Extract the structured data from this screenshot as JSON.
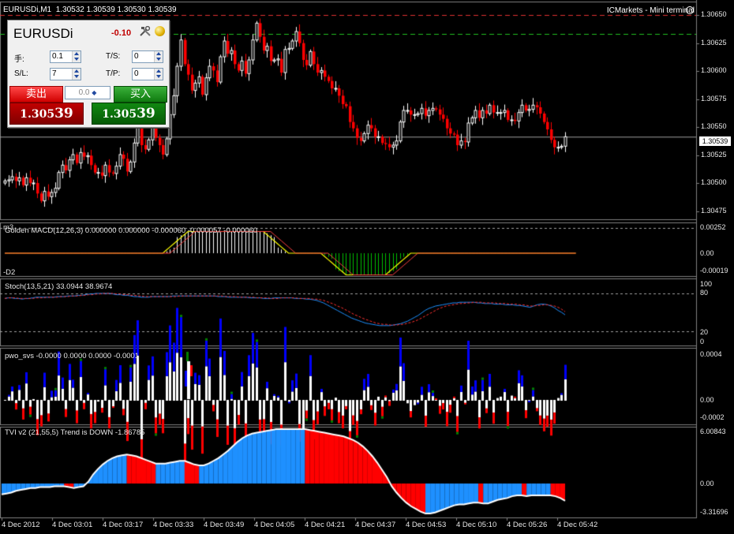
{
  "chart_header": {
    "symbol_tf": "EURUSDi,M1",
    "ohlc": "1.30532 1.30539 1.30530 1.30539",
    "broker": "ICMarkets - Mini terminal"
  },
  "mini_terminal": {
    "symbol": "EURUSDi",
    "pnl": "-0.10",
    "lots_label": "手:",
    "lots_value": "0.1",
    "ts_label": "T/S:",
    "ts_value": "0",
    "sl_label": "S/L:",
    "sl_value": "7",
    "tp_label": "T/P:",
    "tp_value": "0",
    "sell_label": "卖出",
    "buy_label": "买入",
    "spread_value": "0.0",
    "sell_price_main": "1.305",
    "sell_price_big": "39",
    "buy_price_main": "1.305",
    "buy_price_big": "39"
  },
  "colors": {
    "background": "#000000",
    "bull": "#ffffff",
    "bear": "#ff0000",
    "grid": "#5a5a5a",
    "axis_text": "#e8e8e8",
    "macd_signal": "#ffff00",
    "macd_hist_up": "#ffffff",
    "macd_hist_down": "#00c000",
    "stoch_main": "#1e90ff",
    "stoch_signal": "#ff3030",
    "pwo_blue": "#0000ff",
    "pwo_red": "#ff0000",
    "pwo_green": "#008000",
    "tvi_blue": "#1e90ff",
    "tvi_red": "#ff0000"
  },
  "price_axis": {
    "labels": [
      "1.30650",
      "1.30625",
      "1.30600",
      "1.30575",
      "1.30550",
      "1.30525",
      "1.30500",
      "1.30475"
    ],
    "current": "1.30539"
  },
  "panes": {
    "macd": {
      "title": "Golden MACD(12,26,3) 0.000000 0.000000 -0.000060 -0.000057 -0.000060",
      "corner": "m3",
      "sublabel": "-D2",
      "axis": [
        "0.00252",
        "0.00",
        "-0.00019"
      ]
    },
    "stoch": {
      "title": "Stoch(13,5,21) 33.0944 38.9674",
      "axis": [
        "100",
        "80",
        "20",
        "0"
      ]
    },
    "pwo": {
      "title": "pwo_svs -0.0000 0.0000 0.0000 -0.0001",
      "axis": [
        "0.0004",
        "0.00",
        "-0.0002"
      ]
    },
    "tvi": {
      "title": "TVI v2 (21,55,5) Trend is DOWN -1.86785",
      "axis": [
        "6.00843",
        "0.00",
        "-3.31696"
      ]
    }
  },
  "time_axis": [
    "4 Dec 2012",
    "4 Dec 03:01",
    "4 Dec 03:17",
    "4 Dec 03:33",
    "4 Dec 03:49",
    "4 Dec 04:05",
    "4 Dec 04:21",
    "4 Dec 04:37",
    "4 Dec 04:53",
    "4 Dec 05:10",
    "4 Dec 05:26",
    "4 Dec 05:42"
  ],
  "chart_data": {
    "type": "candlestick",
    "price_range": [
      1.30462,
      1.30663
    ],
    "current_price": 1.30539,
    "closes": [
      1.30497,
      1.30498,
      1.30501,
      1.30497,
      1.305,
      1.30493,
      1.305,
      1.30495,
      1.30495,
      1.30485,
      1.30478,
      1.30487,
      1.30482,
      1.30486,
      1.3049,
      1.30505,
      1.30512,
      1.30507,
      1.30517,
      1.30522,
      1.30514,
      1.30524,
      1.3052,
      1.30521,
      1.30512,
      1.30505,
      1.30505,
      1.30502,
      1.30512,
      1.30505,
      1.30504,
      1.30511,
      1.30522,
      1.30518,
      1.30506,
      1.30515,
      1.30533,
      1.30555,
      1.30531,
      1.30527,
      1.30536,
      1.30548,
      1.30538,
      1.30531,
      1.30522,
      1.30537,
      1.3056,
      1.30578,
      1.30606,
      1.30631,
      1.30608,
      1.30598,
      1.30583,
      1.3059,
      1.30596,
      1.30579,
      1.30595,
      1.30606,
      1.30602,
      1.30591,
      1.30615,
      1.3063,
      1.30618,
      1.30621,
      1.30608,
      1.30602,
      1.30611,
      1.30599,
      1.30612,
      1.30631,
      1.30647,
      1.30634,
      1.30621,
      1.30625,
      1.30611,
      1.30612,
      1.30613,
      1.306,
      1.30622,
      1.30623,
      1.3063,
      1.30639,
      1.30628,
      1.30612,
      1.30607,
      1.3062,
      1.30608,
      1.306,
      1.30602,
      1.30596,
      1.30592,
      1.30585,
      1.30585,
      1.30578,
      1.3057,
      1.30568,
      1.30553,
      1.30547,
      1.30538,
      1.30535,
      1.30542,
      1.3055,
      1.30547,
      1.30539,
      1.30539,
      1.30533,
      1.30532,
      1.30529,
      1.30531,
      1.30535,
      1.30553,
      1.30564,
      1.30564,
      1.3056,
      1.3056,
      1.30561,
      1.30566,
      1.30559,
      1.30564,
      1.30566,
      1.30565,
      1.3056,
      1.30556,
      1.30547,
      1.30542,
      1.30541,
      1.30531,
      1.30535,
      1.30534,
      1.30552,
      1.30557,
      1.30564,
      1.30557,
      1.30564,
      1.30561,
      1.30569,
      1.30562,
      1.30562,
      1.30562,
      1.30564,
      1.30555,
      1.30555,
      1.30554,
      1.30562,
      1.30569,
      1.30564,
      1.30565,
      1.30569,
      1.30567,
      1.30561,
      1.30553,
      1.30546,
      1.30536,
      1.30529,
      1.30529,
      1.3053,
      1.30539
    ],
    "macd_hist": [
      0.0,
      -0.0,
      -0.0,
      -0.0,
      -0.0,
      -0.0,
      -0.0,
      -0.0,
      -0.0,
      -0.0,
      -0.0,
      -0.0,
      -0.0,
      -0.0,
      -0.0,
      -0.0,
      -0.0,
      -0.0,
      -0.0,
      -0.0,
      -0.0,
      -0.0,
      -0.0,
      -0.0,
      -0.0,
      -0.0,
      -0.0,
      -0.0,
      -0.0,
      -0.0,
      -0.0,
      -0.0,
      -0.0,
      -0.0,
      -0.0,
      -0.0,
      -0.0,
      -0.0,
      -0.0,
      -0.0,
      -0.0,
      -0.0,
      -0.0,
      -0.0,
      -0.0,
      -0.0,
      -0.0,
      0.0,
      0.0001,
      0.0001,
      0.0001,
      0.0001,
      0.0001,
      0.0001,
      0.0001,
      0.0001,
      0.0001,
      0.0001,
      0.0001,
      0.0001,
      0.0001,
      0.0001,
      0.0001,
      0.0001,
      0.0001,
      0.0001,
      0.0001,
      0.0001,
      0.0001,
      0.0001,
      0.0001,
      0.0001,
      0.0001,
      0.0001,
      0.0001,
      0.0001,
      0.0,
      0.0,
      0.0,
      0.0,
      0.0,
      0.0,
      0.0,
      0.0,
      0.0,
      0.0,
      0.0,
      0.0,
      -0.0,
      -0.0,
      -0.0,
      -0.0,
      -0.0001,
      -0.0001,
      -0.0001,
      -0.0001,
      -0.0001,
      -0.0001,
      -0.0001,
      -0.0001,
      -0.0001,
      -0.0001,
      -0.0001,
      -0.0001,
      -0.0001,
      -0.0001,
      -0.0001,
      -0.0001,
      -0.0001,
      -0.0001,
      -0.0,
      -0.0,
      -0.0,
      -0.0,
      -0.0,
      -0.0,
      -0.0,
      -0.0,
      -0.0,
      -0.0,
      -0.0,
      -0.0,
      -0.0,
      -0.0,
      -0.0,
      -0.0,
      -0.0,
      -0.0,
      -0.0,
      -0.0,
      -0.0,
      -0.0,
      -0.0,
      -0.0,
      -0.0,
      -0.0,
      -0.0,
      -0.0,
      -0.0,
      -0.0,
      -0.0,
      -0.0,
      -0.0,
      -0.0,
      -0.0,
      -0.0,
      -0.0,
      -0.0,
      -0.0,
      -0.0,
      -0.0,
      -0.0,
      -0.0,
      -0.0,
      -0.0,
      -0.0,
      -0.0,
      -0.0,
      -0.0,
      -0.0
    ],
    "stoch_main": [
      72,
      73,
      73,
      72,
      72,
      71,
      72,
      72,
      73,
      74,
      74,
      74,
      74,
      74,
      74,
      75,
      75,
      75,
      76,
      76,
      76,
      77,
      77,
      78,
      79,
      79,
      80,
      80,
      80,
      80,
      80,
      79,
      78,
      78,
      77,
      77,
      76,
      75,
      75,
      74,
      74,
      74,
      75,
      75,
      75,
      75,
      75,
      75,
      76,
      76,
      76,
      76,
      76,
      76,
      76,
      76,
      76,
      76,
      76,
      76,
      76,
      75,
      75,
      75,
      74,
      74,
      74,
      74,
      74,
      74,
      73,
      73,
      73,
      73,
      72,
      72,
      72,
      73,
      73,
      73,
      73,
      73,
      73,
      72,
      72,
      72,
      71,
      71,
      70,
      69,
      67,
      65,
      62,
      59,
      56,
      53,
      50,
      47,
      44,
      41,
      39,
      37,
      35,
      33,
      32,
      31,
      30,
      29,
      29,
      29,
      29,
      30,
      31,
      32,
      34,
      36,
      39,
      42,
      45,
      49,
      53,
      56,
      58,
      60,
      61,
      62,
      63,
      64,
      65,
      65,
      66,
      66,
      66,
      66,
      66,
      65,
      65,
      64,
      64,
      64,
      63,
      63,
      63,
      62,
      62,
      62,
      61,
      61,
      60,
      59,
      58,
      60,
      62,
      63,
      63,
      62,
      60,
      57,
      53,
      50,
      46
    ],
    "stoch_signal": [
      72,
      73,
      73,
      73,
      72,
      72,
      72,
      72,
      72,
      73,
      73,
      73,
      74,
      74,
      74,
      74,
      75,
      75,
      75,
      76,
      76,
      76,
      77,
      77,
      78,
      78,
      79,
      79,
      80,
      80,
      80,
      80,
      79,
      79,
      78,
      78,
      77,
      77,
      76,
      76,
      75,
      75,
      75,
      75,
      75,
      75,
      75,
      75,
      75,
      75,
      76,
      76,
      76,
      76,
      76,
      76,
      76,
      76,
      76,
      76,
      76,
      76,
      76,
      75,
      75,
      75,
      75,
      74,
      74,
      74,
      74,
      74,
      73,
      73,
      73,
      73,
      72,
      72,
      72,
      73,
      73,
      73,
      73,
      73,
      72,
      72,
      72,
      72,
      71,
      71,
      70,
      69,
      67,
      65,
      63,
      60,
      58,
      55,
      52,
      49,
      46,
      44,
      41,
      39,
      37,
      35,
      33,
      32,
      31,
      31,
      30,
      30,
      30,
      31,
      31,
      33,
      34,
      36,
      38,
      41,
      44,
      47,
      50,
      53,
      56,
      58,
      60,
      61,
      62,
      63,
      64,
      64,
      65,
      65,
      66,
      66,
      66,
      65,
      65,
      65,
      65,
      64,
      64,
      64,
      63,
      63,
      63,
      62,
      62,
      61,
      60,
      60,
      61,
      61,
      62,
      62,
      61,
      60,
      58,
      55,
      51
    ],
    "tvi": [
      -1.2,
      -1.1,
      -1.0,
      -0.8,
      -0.7,
      -0.6,
      -0.5,
      -0.5,
      -0.4,
      -0.4,
      -0.4,
      -0.3,
      -0.3,
      -0.3,
      -0.4,
      -0.5,
      -0.4,
      -0.3,
      0.2,
      1.0,
      1.6,
      2.1,
      2.5,
      2.8,
      3.0,
      3.1,
      3.2,
      3.1,
      3.0,
      2.8,
      2.6,
      2.4,
      2.2,
      2.2,
      2.2,
      2.3,
      2.4,
      2.5,
      2.5,
      2.3,
      2.1,
      2.0,
      2.0,
      2.2,
      2.5,
      2.8,
      3.2,
      3.6,
      4.1,
      4.6,
      5.0,
      5.3,
      5.5,
      5.6,
      5.7,
      5.8,
      5.9,
      6.0,
      6.0,
      6.0,
      6.0,
      6.0,
      6.0,
      6.0,
      5.9,
      5.8,
      5.7,
      5.6,
      5.5,
      5.4,
      5.3,
      5.2,
      5.0,
      4.8,
      4.5,
      4.1,
      3.6,
      3.0,
      2.3,
      1.5,
      0.7,
      -0.3,
      -1.0,
      -1.6,
      -2.1,
      -2.5,
      -2.8,
      -3.1,
      -3.3,
      -3.3,
      -3.2,
      -3.0,
      -2.8,
      -2.6,
      -2.4,
      -2.3,
      -2.3,
      -2.2,
      -2.1,
      -2.1,
      -2.2,
      -2.2,
      -2.0,
      -1.8,
      -1.7,
      -1.6,
      -1.4,
      -1.3,
      -1.3,
      -1.4,
      -1.3,
      -1.3,
      -1.3,
      -1.3,
      -1.3,
      -1.4,
      -1.6,
      -1.9
    ]
  }
}
